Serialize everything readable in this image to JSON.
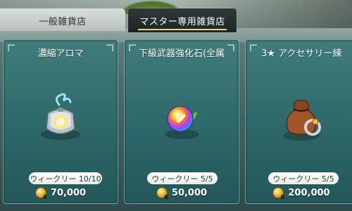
{
  "tabs": {
    "general_store": "一般雑貨店",
    "master_store": "マスター専用雑貨店"
  },
  "items": [
    {
      "name": "濃縮アロマ",
      "limit": "ウィークリー 10/10",
      "price": "70,000",
      "icon": "aroma-lantern-icon"
    },
    {
      "name": "下級武器強化石(全属",
      "limit": "ウィークリー 5/5",
      "price": "50,000",
      "icon": "rainbow-stone-icon"
    },
    {
      "name": "3★ アクセサリー練",
      "limit": "ウィークリー 5/5",
      "price": "200,000",
      "icon": "accessory-bag-icon"
    }
  ],
  "currency_icon": "gold-coin-icon",
  "colors": {
    "card_bg": "#2c686a",
    "active_tab": "#1c2424",
    "accent_gold": "#e9d27a"
  }
}
